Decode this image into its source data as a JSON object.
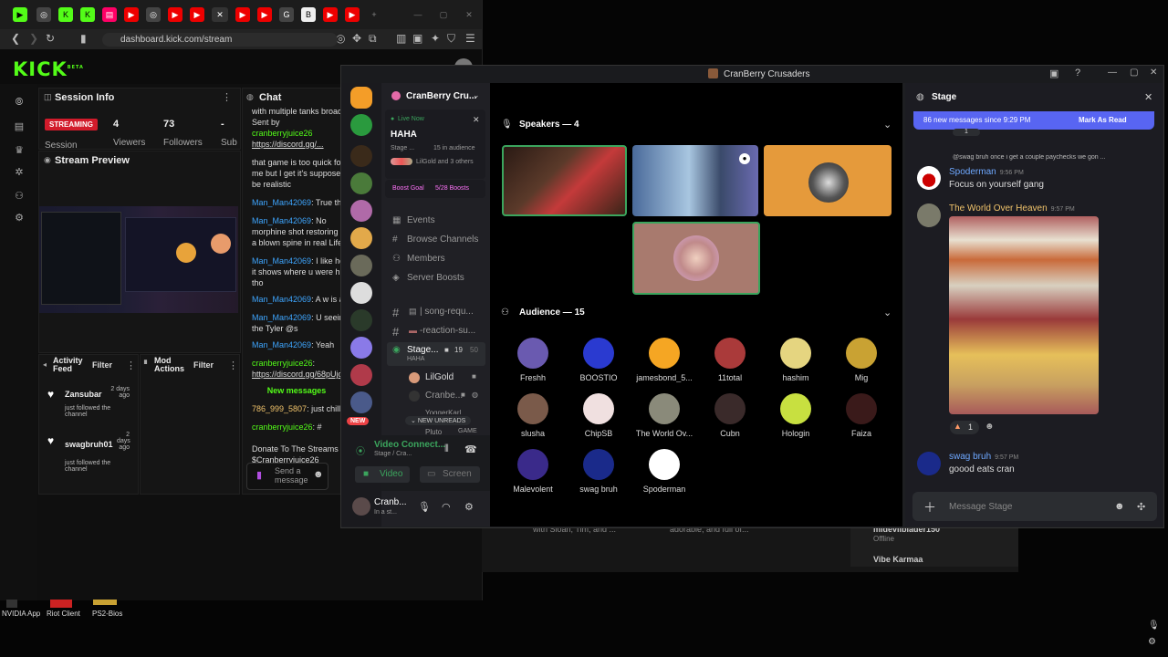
{
  "browser": {
    "url": "dashboard.kick.com/stream",
    "logo": "KICK",
    "logo_tag": "BETA"
  },
  "kick": {
    "session_info_title": "Session Info",
    "streaming_badge": "STREAMING",
    "session_label": "Session",
    "viewers_value": "4",
    "viewers_label": "Viewers",
    "followers_value": "73",
    "followers_label": "Followers",
    "sub_value": "-",
    "sub_label": "Sub",
    "stream_preview_title": "Stream Preview",
    "chat_title": "Chat",
    "activity_feed_title": "Activity Feed",
    "filter_label": "Filter",
    "mod_actions_title": "Mod Actions",
    "activity": [
      {
        "user": "Zansubar",
        "time": "2 days ago",
        "text": "just followed the channel"
      },
      {
        "user": "swagbruh01",
        "time": "2 days ago",
        "text": "just followed the channel"
      }
    ],
    "chat": [
      {
        "user": "",
        "text": "with multiple tanks broadc"
      },
      {
        "user": "",
        "text": "Sent by"
      },
      {
        "user": "cranberryjuice26",
        "text": ""
      },
      {
        "user": "",
        "text": "https://discord.gg/..."
      },
      {
        "user": "",
        "text": "that game is too quick for"
      },
      {
        "user": "",
        "text": "me but I get it's supposed"
      },
      {
        "user": "",
        "text": "be realistic"
      },
      {
        "user": "Man_Man42069",
        "text": ": True tha"
      },
      {
        "user": "Man_Man42069",
        "text": ": No"
      },
      {
        "user": "",
        "text": "morphine shot restoring o"
      },
      {
        "user": "",
        "text": "a blown spine in real Life"
      },
      {
        "user": "Man_Man42069",
        "text": ": I like ho"
      },
      {
        "user": "",
        "text": "it shows where u were hit"
      },
      {
        "user": "",
        "text": "tho"
      },
      {
        "user": "Man_Man42069",
        "text": ": A w is a"
      },
      {
        "user": "Man_Man42069",
        "text": ": U seein"
      },
      {
        "user": "",
        "text": "the Tyler @s"
      },
      {
        "user": "Man_Man42069",
        "text": ": Yeah"
      },
      {
        "user": "cranberryjuice26",
        "text": ":"
      },
      {
        "user": "",
        "text": "https://discord.gg/68pUjc"
      },
      {
        "user": "",
        "text": "New messages"
      },
      {
        "user": "786_999_5807",
        "text": ": just chillin"
      },
      {
        "user": "cranberryjuice26",
        "text": ": #"
      },
      {
        "user": "",
        "text": "Donate To The Streams"
      },
      {
        "user": "",
        "text": "$Cranberryjuice26"
      }
    ],
    "send_placeholder": "Send a message"
  },
  "discord": {
    "window_title": "CranBerry Crusaders",
    "server_name": "CranBerry Cru...",
    "live_now": "Live Now",
    "stage_title": "HAHA",
    "stage_sub": "Stage ...",
    "in_audience": "15 in audience",
    "others": "LilGold and 3 others",
    "boost_goal": "Boost Goal",
    "boosts": "5/28 Boosts",
    "menu": [
      "Events",
      "Browse Channels",
      "Members",
      "Server Boosts"
    ],
    "channels": [
      "| song-requ...",
      "-reaction-su..."
    ],
    "stage_channel": "Stage...",
    "stage_channel_sub": "HAHA",
    "stage_count": "19",
    "stage_max": "50",
    "stage_users": [
      "LilGold",
      "Cranbe...",
      "YoggerKarl...",
      "Pluto"
    ],
    "game_tag": "GAME",
    "new_unreads": "NEW UNREADS",
    "new_badge": "NEW",
    "voice_status": "Video Connect...",
    "voice_sub": "Stage / Cra...",
    "video_btn": "Video",
    "screen_btn": "Screen",
    "user_name": "Cranb...",
    "user_status": "In a st...",
    "speakers_label": "Speakers — 4",
    "audience_label": "Audience — 15",
    "audience": [
      "Freshh",
      "BOOSTIO",
      "jamesbond_5...",
      "11total",
      "hashim",
      "Mig",
      "slusha",
      "ChipSB",
      "The World Ov...",
      "Cubn",
      "Hologin",
      "Faiza",
      "Malevolent",
      "swag bruh",
      "Spoderman"
    ],
    "chat_title": "Stage",
    "new_messages_bar": "86 new messages since 9:29 PM",
    "mark_as_read": "Mark As Read",
    "reply_line": "@swag bruh once i get a couple paychecks we gon ...",
    "msgs": [
      {
        "user": "Spoderman",
        "time": "9:56 PM",
        "text": "Focus on yourself gang"
      },
      {
        "user": "The World Over Heaven",
        "time": "9:57 PM",
        "text": ""
      },
      {
        "user": "swag bruh",
        "time": "9:57 PM",
        "text": "goood eats cran"
      }
    ],
    "reaction_count": "1",
    "reaction_count_top": "1",
    "message_placeholder": "Message Stage"
  },
  "background": {
    "text1": "with Sloan, Tim, and ...",
    "text2": "adorable, and full of...",
    "user1": "mideviiblader150",
    "user1_status": "Offline",
    "user2": "Vibe Karmaa"
  },
  "taskbar": [
    "NVIDIA App",
    "Riot Client",
    "PS2-Bios"
  ],
  "colors": {
    "kick_green": "#53fc18",
    "discord_blurple": "#5865f2",
    "speaking_green": "#3ba55d"
  }
}
